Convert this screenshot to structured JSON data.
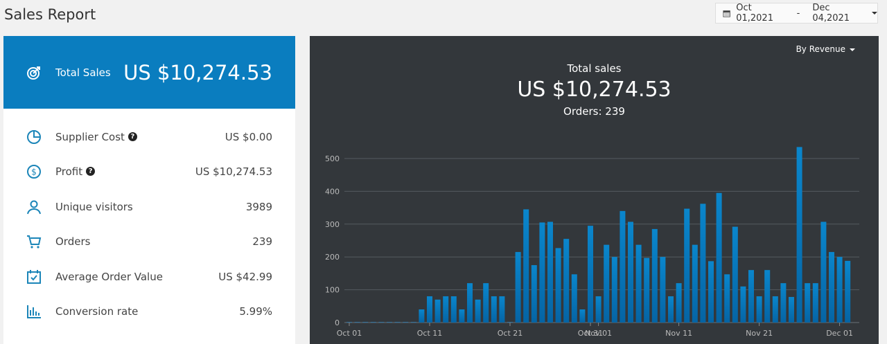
{
  "header": {
    "title": "Sales Report",
    "date_from": "Oct 01,2021",
    "date_sep": "-",
    "date_to": "Dec 04,2021"
  },
  "summary": {
    "total_label": "Total Sales",
    "total_value": "US $10,274.53",
    "metrics": [
      {
        "icon": "pie-chart-icon",
        "label": "Supplier Cost",
        "help": true,
        "value": "US $0.00"
      },
      {
        "icon": "dollar-circle-icon",
        "label": "Profit",
        "help": true,
        "value": "US $10,274.53"
      },
      {
        "icon": "user-icon",
        "label": "Unique visitors",
        "help": false,
        "value": "3989"
      },
      {
        "icon": "cart-icon",
        "label": "Orders",
        "help": false,
        "value": "239"
      },
      {
        "icon": "calendar-check-icon",
        "label": "Average Order Value",
        "help": false,
        "value": "US $42.99"
      },
      {
        "icon": "bar-chart-icon",
        "label": "Conversion rate",
        "help": false,
        "value": "5.99%"
      }
    ]
  },
  "panel": {
    "metric_select": "By Revenue",
    "title": "Total sales",
    "total": "US $10,274.53",
    "orders": "Orders: 239"
  },
  "colors": {
    "accent": "#0a7dbf",
    "panel": "#33373b",
    "bar": "#0a7dbf"
  },
  "chart_data": {
    "type": "bar",
    "x_start": "Oct 01",
    "x_end": "Dec 02",
    "xticks": [
      "Oct 01",
      "Oct 11",
      "Oct 21",
      "Oct 31",
      "Nov 01",
      "Nov 11",
      "Nov 21",
      "Dec 01"
    ],
    "xtick_days": [
      0,
      10,
      20,
      30,
      31,
      41,
      51,
      61
    ],
    "ylim": [
      0,
      500
    ],
    "yticks": [
      0,
      100,
      200,
      300,
      400,
      500
    ],
    "grid": true,
    "values": [
      0,
      0,
      0,
      0,
      0,
      0,
      0,
      0,
      0,
      40,
      80,
      70,
      80,
      80,
      40,
      120,
      70,
      120,
      80,
      80,
      0,
      215,
      345,
      175,
      305,
      307,
      227,
      255,
      147,
      40,
      295,
      80,
      237,
      200,
      340,
      307,
      237,
      197,
      285,
      200,
      80,
      120,
      347,
      237,
      362,
      187,
      395,
      147,
      292,
      110,
      160,
      80,
      160,
      80,
      120,
      78,
      535,
      120,
      120,
      307,
      215,
      200,
      188
    ]
  }
}
